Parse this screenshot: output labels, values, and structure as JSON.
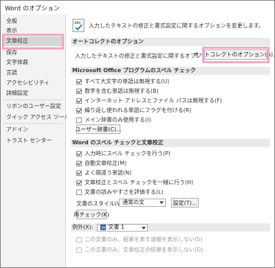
{
  "window": {
    "title": "Word のオプション"
  },
  "sidebar": {
    "items": [
      {
        "label": "全般"
      },
      {
        "label": "表示"
      },
      {
        "label": "文章校正"
      },
      {
        "label": "保存"
      },
      {
        "label": "文字体裁"
      },
      {
        "label": "言語"
      },
      {
        "label": "アクセシビリティ"
      },
      {
        "label": "詳細設定"
      },
      {
        "label": "リボンのユーザー設定"
      },
      {
        "label": "クイック アクセス ツール バー"
      },
      {
        "label": "アドイン"
      },
      {
        "label": "トラスト センター"
      }
    ],
    "selected": "文章校正"
  },
  "header": {
    "text": "入力したテキストの修正と書式設定に関するオプションを変更します。"
  },
  "autocorrect": {
    "title": "オートコレクトのオプション",
    "desc": "入力したテキストの修正と書式設定に関するオプションを変更します:",
    "button": "オートコレクトのオプション(A)..."
  },
  "office_spell": {
    "title": "Microsoft Office プログラムのスペル チェック",
    "options": [
      {
        "label": "すべて大文字の単語は無視する(U)",
        "checked": true
      },
      {
        "label": "数字を含む単語は無視する(B)",
        "checked": true
      },
      {
        "label": "インターネット アドレスとファイル パスは無視する(F)",
        "checked": true
      },
      {
        "label": "繰り返し使われる単語にフラグを付ける(R)",
        "checked": true
      },
      {
        "label": "メイン辞書のみ使用する(I)",
        "checked": false
      }
    ],
    "dict_button": "ユーザー辞書(C)..."
  },
  "word_spell": {
    "title": "Word のスペル チェックと文章校正",
    "options": [
      {
        "label": "入力時にスペル チェックを行う(P)",
        "checked": true
      },
      {
        "label": "自動文章校正(M)",
        "checked": true
      },
      {
        "label": "よく間違う単語(N)",
        "checked": true
      },
      {
        "label": "文章校正とスペル チェックを一緒に行う(H)",
        "checked": true
      },
      {
        "label": "文書の読みやすさを評価する(L)",
        "checked": false
      }
    ],
    "style_label": "文書のスタイル(W):",
    "style_value": "通常の文",
    "settings_button": "設定(T)...",
    "recheck_button": "再チェック(K)"
  },
  "exceptions": {
    "label": "例外(X):",
    "doc_value": "文書 1",
    "options": [
      {
        "label": "この文書のみ、結果を表す波線を表示しない(S)",
        "checked": false
      },
      {
        "label": "この文書のみ、文章校正の結果を表示しない(D)",
        "checked": false
      }
    ]
  },
  "colors": {
    "highlight": "#f2a6c6",
    "selected_bg": "#d6d6d6",
    "section_bg": "#eaeaea"
  }
}
